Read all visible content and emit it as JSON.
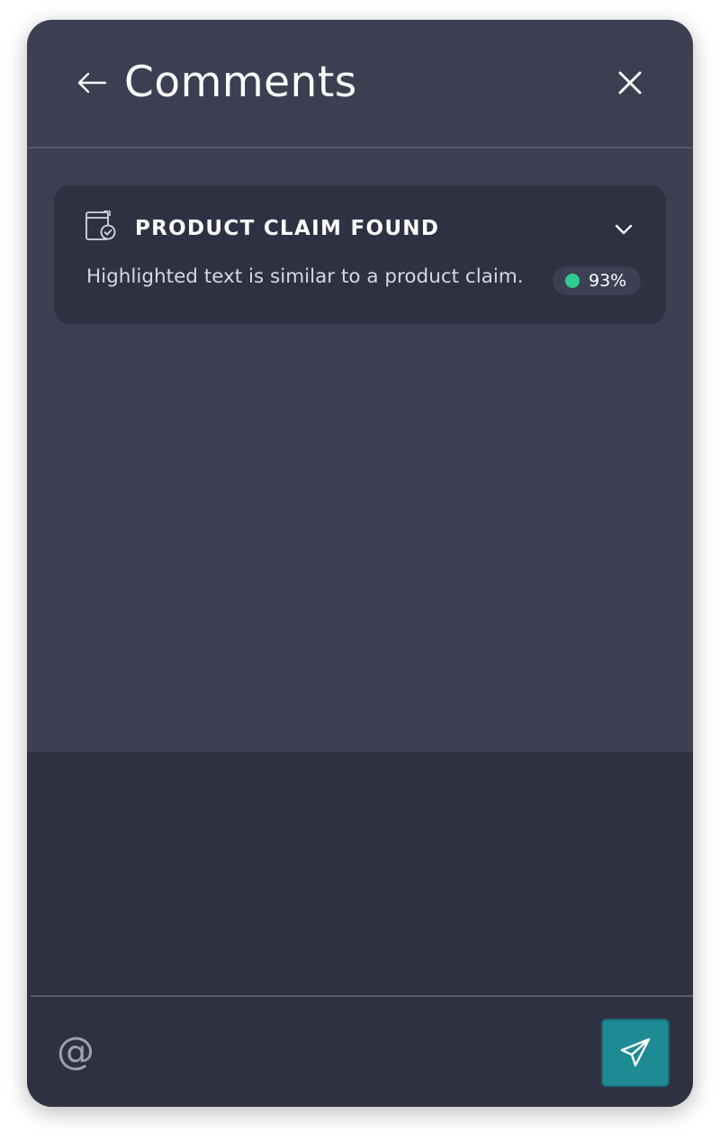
{
  "header": {
    "title": "Comments",
    "back_icon": "arrow-left-icon",
    "close_icon": "close-icon"
  },
  "claim_card": {
    "icon": "document-check-icon",
    "title": "PRODUCT CLAIM FOUND",
    "toggle_icon": "chevron-down-icon",
    "description": "Highlighted text is similar to a product claim.",
    "score": "93%",
    "score_color": "#2ecc8e"
  },
  "composer": {
    "input_value": "",
    "mention_label": "@",
    "send_icon": "paper-plane-icon",
    "send_color": "#1e8a94"
  },
  "colors": {
    "panel_bg": "#3b3f51",
    "card_bg": "#2e3142",
    "text": "#ffffff"
  }
}
